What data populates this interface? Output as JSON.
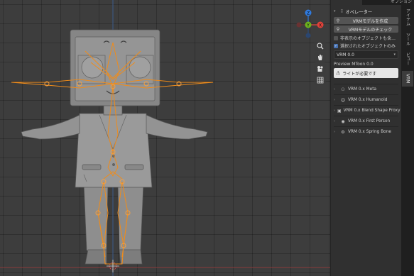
{
  "top_bar": {
    "options_label": "オプション"
  },
  "viewport": {
    "gizmo": {
      "y_label": "Y",
      "x_label": "X",
      "z_label": "Z"
    },
    "tools": [
      "zoom-icon",
      "hand-icon",
      "camera-icon",
      "grid-icon"
    ]
  },
  "sidebar": {
    "operator_header": "オペレーター",
    "create_button": "VRMモデルを作成",
    "check_button": "VRMモデルのチェック",
    "checkbox_hidden": {
      "label": "非表示のオブジェクトも含…",
      "checked": false
    },
    "checkbox_selected": {
      "label": "選択されたオブジェクトのみ",
      "checked": true
    },
    "version_select": "VRM 0.0",
    "preview_label": "Preview MToon 0.0",
    "warning_text": "ライトが必要です",
    "panels": [
      {
        "label": "VRM 0.x Meta",
        "icon": "meta-icon"
      },
      {
        "label": "VRM 0.x Humanoid",
        "icon": "humanoid-icon"
      },
      {
        "label": "VRM 0.x Blend Shape Proxy",
        "icon": "blendshape-icon"
      },
      {
        "label": "VRM 0.x First Person",
        "icon": "eye-icon"
      },
      {
        "label": "VRM 0.x Spring Bone",
        "icon": "spring-bone-icon"
      }
    ]
  },
  "tabs": [
    "アイテム",
    "ツール",
    "ビュー",
    "VRM"
  ],
  "active_tab": "VRM",
  "colors": {
    "armature": "#f08c1a",
    "accent": "#4772b3",
    "x_axis": "#e0423a",
    "y_axis": "#6cb31e",
    "z_axis": "#2f7be0"
  }
}
